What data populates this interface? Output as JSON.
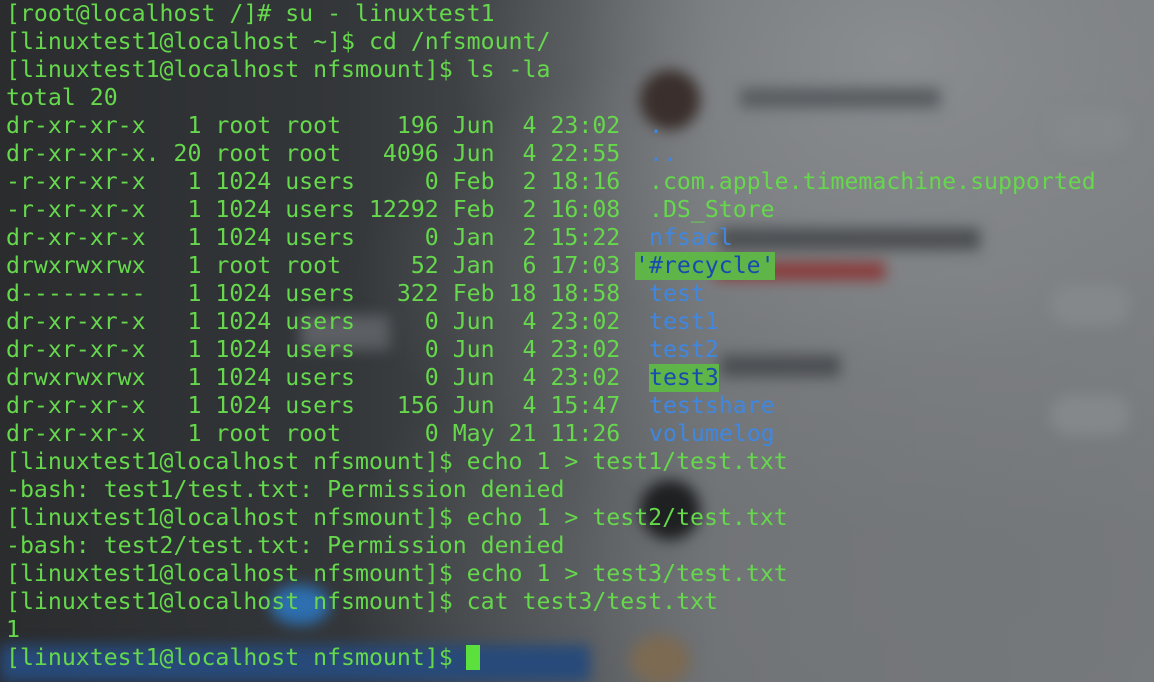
{
  "terminal": {
    "lines": [
      "[root@localhost /]# su - linuxtest1",
      "[linuxtest1@localhost ~]$ cd /nfsmount/",
      "[linuxtest1@localhost nfsmount]$ ls -la",
      "total 20",
      "dr-xr-xr-x   1 root root    196 Jun  4 23:02",
      "dr-xr-xr-x. 20 root root   4096 Jun  4 22:55",
      "-r-xr-xr-x   1 1024 users     0 Feb  2 18:16",
      "-r-xr-xr-x   1 1024 users 12292 Feb  2 16:08",
      "dr-xr-xr-x   1 1024 users     0 Jan  2 15:22",
      "drwxrwxrwx   1 root root     52 Jan  6 17:03",
      "d---------   1 1024 users   322 Feb 18 18:58",
      "dr-xr-xr-x   1 1024 users     0 Jun  4 23:02",
      "dr-xr-xr-x   1 1024 users     0 Jun  4 23:02",
      "drwxrwxrwx   1 1024 users     0 Jun  4 23:02",
      "dr-xr-xr-x   1 1024 users   156 Jun  4 15:47",
      "dr-xr-xr-x   1 root root      0 May 21 11:26",
      "[linuxtest1@localhost nfsmount]$ echo 1 > test1/test.txt",
      "-bash: test1/test.txt: Permission denied",
      "[linuxtest1@localhost nfsmount]$ echo 1 > test2/test.txt",
      "-bash: test2/test.txt: Permission denied",
      "[linuxtest1@localhost nfsmount]$ echo 1 > test3/test.txt",
      "[linuxtest1@localhost nfsmount]$ cat test3/test.txt",
      "1",
      "[linuxtest1@localhost nfsmount]$ "
    ],
    "file_names": [
      ".",
      "..",
      ".com.apple.timemachine.supported",
      ".DS_Store",
      "nfsacl",
      "'#recycle'",
      "test",
      "test1",
      "test2",
      "test3",
      "testshare",
      "volumelog"
    ],
    "colors": {
      "text": "#65d84c",
      "directory": "#3f87e0",
      "highlight_bg": "#5fb548",
      "highlight_fg": "#1a49b0",
      "cursor": "#5ce03e"
    }
  }
}
